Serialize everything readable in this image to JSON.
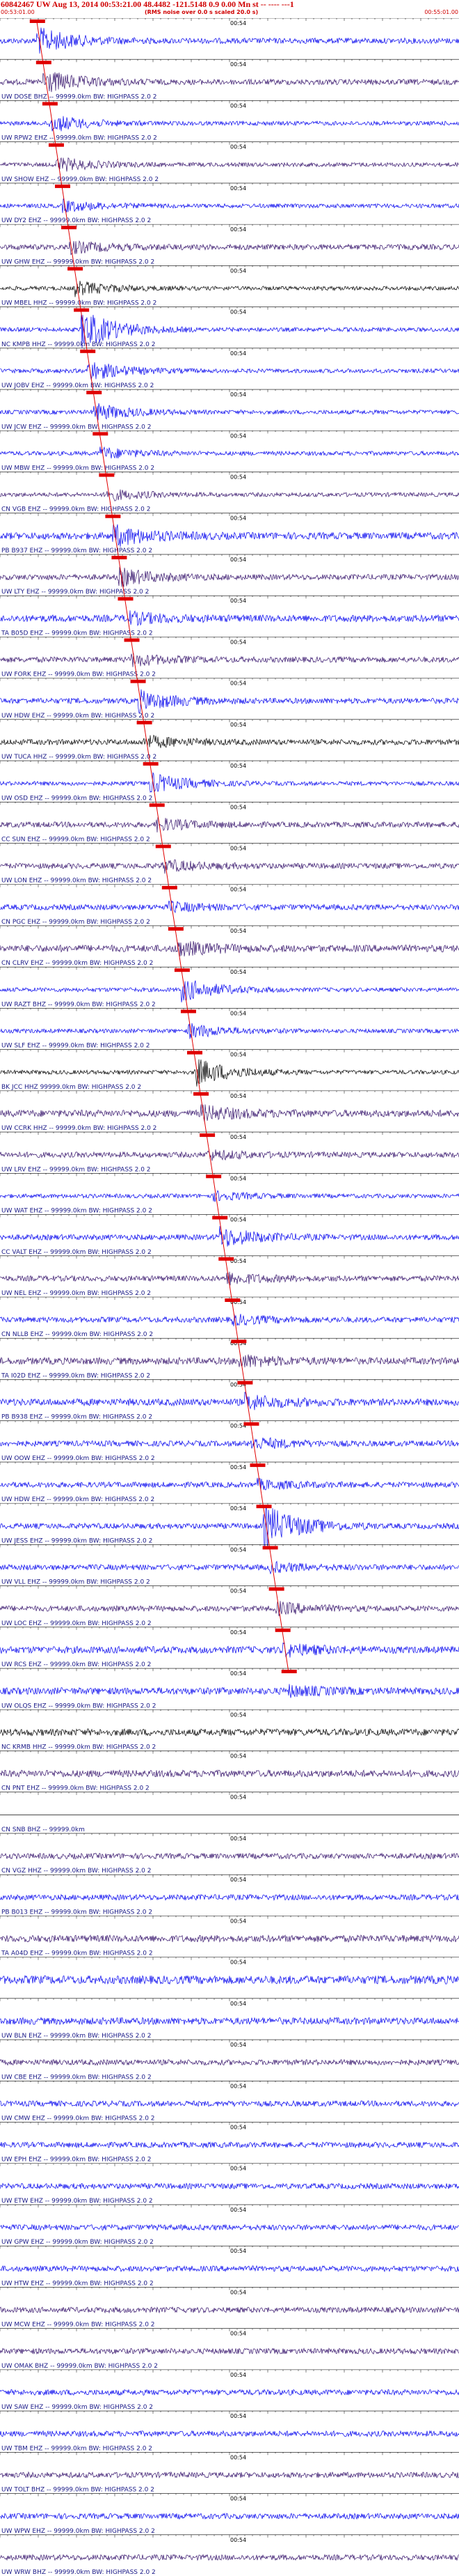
{
  "header": {
    "title": "60842467 UW Aug 13, 2014 00:53:21.00   48.4482 -121.5148   0.9 0.00 Mn st -- ---- ---1",
    "subtitle": "(RMS noise over 0.0 s scaled 20.0 s)",
    "time_left": "00:53:01.00",
    "time_right": "00:55:01.00"
  },
  "tick_time": "00:54",
  "colors": {
    "pick": "#e00000",
    "blue": "#0000ee",
    "purple": "#33106a",
    "black": "#000000"
  },
  "traces": [
    {
      "label": "",
      "color": "blue",
      "amp": 18,
      "noise": 4,
      "event": true
    },
    {
      "label": "UW DOSE BHZ -- 99999.0km BW: HIGHPASS 2.0 2",
      "color": "purple",
      "amp": 16,
      "noise": 4,
      "event": true
    },
    {
      "label": "UW RPW2 EHZ -- 99999.0km BW: HIGHPASS 2.0 2",
      "color": "blue",
      "amp": 12,
      "noise": 3,
      "event": true
    },
    {
      "label": "UW SHOW EHZ -- 99999.0km BW: HIGHPASS 2.0 2",
      "color": "purple",
      "amp": 10,
      "noise": 3,
      "event": true
    },
    {
      "label": "UW DY2 EHZ -- 99999.0km BW: HIGHPASS 2.0 2",
      "color": "blue",
      "amp": 8,
      "noise": 3,
      "event": true
    },
    {
      "label": "UW GHW EHZ -- 99999.0km BW: HIGHPASS 2.0 2",
      "color": "purple",
      "amp": 8,
      "noise": 4,
      "event": true
    },
    {
      "label": "UW MBEL HHZ -- 99999.0km BW: HIGHPASS 2.0 2",
      "color": "black",
      "amp": 10,
      "noise": 3,
      "event": true
    },
    {
      "label": "NC KMPB HHZ -- 99999.0km BW: HIGHPASS 2.0 2",
      "color": "blue",
      "amp": 28,
      "noise": 3,
      "event": true
    },
    {
      "label": "UW JOBV EHZ -- 99999.0km BW: HIGHPASS 2.0 2",
      "color": "blue",
      "amp": 14,
      "noise": 3,
      "event": true
    },
    {
      "label": "UW JCW EHZ -- 99999.0km BW: HIGHPASS 2.0 2",
      "color": "blue",
      "amp": 12,
      "noise": 3,
      "event": true
    },
    {
      "label": "UW MBW EHZ -- 99999.0km BW: HIGHPASS 2.0 2",
      "color": "blue",
      "amp": 8,
      "noise": 3,
      "event": true
    },
    {
      "label": "CN VGB EHZ -- 99999.0km BW: HIGHPASS 2.0 2",
      "color": "purple",
      "amp": 8,
      "noise": 3,
      "event": true
    },
    {
      "label": "PB B937 EHZ -- 99999.0km BW: HIGHPASS 2.0 2",
      "color": "blue",
      "amp": 14,
      "noise": 5,
      "event": true
    },
    {
      "label": "UW LTY EHZ -- 99999.0km BW: HIGHPASS 2.0 2",
      "color": "purple",
      "amp": 12,
      "noise": 4,
      "event": true
    },
    {
      "label": "TA B05D EHZ -- 99999.0km BW: HIGHPASS 2.0 2",
      "color": "blue",
      "amp": 8,
      "noise": 5,
      "event": true
    },
    {
      "label": "UW FORK EHZ -- 99999.0km BW: HIGHPASS 2.0 2",
      "color": "purple",
      "amp": 8,
      "noise": 4,
      "event": true
    },
    {
      "label": "UW HDW EHZ -- 99999.0km BW: HIGHPASS 2.0 2",
      "color": "blue",
      "amp": 14,
      "noise": 4,
      "event": true
    },
    {
      "label": "UW TUCA HHZ -- 99999.0km BW: HIGHPASS 2.0 2",
      "color": "black",
      "amp": 8,
      "noise": 4,
      "event": true
    },
    {
      "label": "UW OSD EHZ -- 99999.0km BW: HIGHPASS 2.0 2",
      "color": "blue",
      "amp": 14,
      "noise": 3,
      "event": true
    },
    {
      "label": "CC SUN EHZ -- 99999.0km BW: HIGHPASS 2.0 2",
      "color": "purple",
      "amp": 8,
      "noise": 4,
      "event": true
    },
    {
      "label": "UW LON EHZ -- 99999.0km BW: HIGHPASS 2.0 2",
      "color": "purple",
      "amp": 8,
      "noise": 4,
      "event": true
    },
    {
      "label": "CN PGC EHZ -- 99999.0km BW: HIGHPASS 2.0 2",
      "color": "blue",
      "amp": 6,
      "noise": 4,
      "event": true
    },
    {
      "label": "CN CLRV EHZ -- 99999.0km BW: HIGHPASS 2.0 2",
      "color": "purple",
      "amp": 10,
      "noise": 5,
      "event": true
    },
    {
      "label": "UW RAZT BHZ -- 99999.0km BW: HIGHPASS 2.0 2",
      "color": "blue",
      "amp": 16,
      "noise": 3,
      "event": true
    },
    {
      "label": "UW SLF EHZ -- 99999.0km BW: HIGHPASS 2.0 2",
      "color": "blue",
      "amp": 10,
      "noise": 3,
      "event": true
    },
    {
      "label": "BK JCC HHZ 99999.0km BW: HIGHPASS 2.0 2",
      "color": "black",
      "amp": 20,
      "noise": 3,
      "event": true
    },
    {
      "label": "UW CCRK HHZ -- 99999.0km BW: HIGHPASS 2.0 2",
      "color": "purple",
      "amp": 10,
      "noise": 5,
      "event": true
    },
    {
      "label": "UW LRV EHZ -- 99999.0km BW: HIGHPASS 2.0 2",
      "color": "purple",
      "amp": 6,
      "noise": 4,
      "event": true
    },
    {
      "label": "UW WAT EHZ -- 99999.0km BW: HIGHPASS 2.0 2",
      "color": "blue",
      "amp": 6,
      "noise": 3,
      "event": true
    },
    {
      "label": "CC VALT EHZ -- 99999.0km BW: HIGHPASS 2.0 2",
      "color": "blue",
      "amp": 14,
      "noise": 4,
      "event": true
    },
    {
      "label": "UW NEL EHZ -- 99999.0km BW: HIGHPASS 2.0 2",
      "color": "purple",
      "amp": 8,
      "noise": 4,
      "event": true
    },
    {
      "label": "CN NLLB EHZ -- 99999.0km BW: HIGHPASS 2.0 2",
      "color": "blue",
      "amp": 6,
      "noise": 4,
      "event": true
    },
    {
      "label": "TA I02D EHZ -- 99999.0km BW: HIGHPASS 2.0 2",
      "color": "purple",
      "amp": 8,
      "noise": 5,
      "event": true
    },
    {
      "label": "PB B938 EHZ -- 99999.0km BW: HIGHPASS 2.0 2",
      "color": "blue",
      "amp": 10,
      "noise": 5,
      "event": true
    },
    {
      "label": "UW OOW EHZ -- 99999.0km BW: HIGHPASS 2.0 2",
      "color": "blue",
      "amp": 8,
      "noise": 4,
      "event": true
    },
    {
      "label": "UW HDW EHZ -- 99999.0km BW: HIGHPASS 2.0 2",
      "color": "blue",
      "amp": 6,
      "noise": 4,
      "event": true
    },
    {
      "label": "UW JESS EHZ -- 99999.0km BW: HIGHPASS 2.0 2",
      "color": "blue",
      "amp": 30,
      "noise": 4,
      "event": true
    },
    {
      "label": "UW VLL EHZ -- 99999.0km BW: HIGHPASS 2.0 2",
      "color": "blue",
      "amp": 6,
      "noise": 4,
      "event": true
    },
    {
      "label": "UW LOC EHZ -- 99999.0km BW: HIGHPASS 2.0 2",
      "color": "purple",
      "amp": 8,
      "noise": 4,
      "event": true
    },
    {
      "label": "UW RCS EHZ -- 99999.0km BW: HIGHPASS 2.0 2",
      "color": "blue",
      "amp": 8,
      "noise": 5,
      "event": true
    },
    {
      "label": "UW OLQS EHZ -- 99999.0km BW: HIGHPASS 2.0 2",
      "color": "blue",
      "amp": 6,
      "noise": 5,
      "event": true
    },
    {
      "label": "NC KRMB HHZ -- 99999.0km BW: HIGHPASS 2.0 2",
      "color": "black",
      "amp": 6,
      "noise": 5,
      "event": false
    },
    {
      "label": "CN PNT EHZ -- 99999.0km BW: HIGHPASS 2.0 2",
      "color": "purple",
      "amp": 6,
      "noise": 5,
      "event": false
    },
    {
      "label": "CN SNB BHZ -- 99999.0km",
      "color": "black",
      "amp": 0,
      "noise": 0,
      "event": false
    },
    {
      "label": "CN VGZ HHZ -- 99999.0km BW: HIGHPASS 2.0 2",
      "color": "purple",
      "amp": 6,
      "noise": 4,
      "event": false
    },
    {
      "label": "PB B013 EHZ -- 99999.0km BW: HIGHPASS 2.0 2",
      "color": "blue",
      "amp": 6,
      "noise": 4,
      "event": false
    },
    {
      "label": "TA A04D EHZ -- 99999.0km BW: HIGHPASS 2.0 2",
      "color": "purple",
      "amp": 6,
      "noise": 5,
      "event": false
    },
    {
      "label": "",
      "color": "blue",
      "amp": 6,
      "noise": 6,
      "event": false
    },
    {
      "label": "UW BLN EHZ -- 99999.0km BW: HIGHPASS 2.0 2",
      "color": "blue",
      "amp": 6,
      "noise": 5,
      "event": false
    },
    {
      "label": "UW CBE EHZ -- 99999.0km BW: HIGHPASS 2.0 2",
      "color": "purple",
      "amp": 6,
      "noise": 4,
      "event": false
    },
    {
      "label": "UW CMW EHZ -- 99999.0km BW: HIGHPASS 2.0 2",
      "color": "blue",
      "amp": 6,
      "noise": 4,
      "event": false
    },
    {
      "label": "UW EPH EHZ -- 99999.0km BW: HIGHPASS 2.0 2",
      "color": "blue",
      "amp": 6,
      "noise": 4,
      "event": false
    },
    {
      "label": "UW ETW EHZ -- 99999.0km BW: HIGHPASS 2.0 2",
      "color": "blue",
      "amp": 6,
      "noise": 4,
      "event": false
    },
    {
      "label": "UW GPW EHZ -- 99999.0km BW: HIGHPASS 2.0 2",
      "color": "blue",
      "amp": 6,
      "noise": 4,
      "event": false
    },
    {
      "label": "UW HTW EHZ -- 99999.0km BW: HIGHPASS 2.0 2",
      "color": "blue",
      "amp": 6,
      "noise": 4,
      "event": false
    },
    {
      "label": "UW MCW EHZ -- 99999.0km BW: HIGHPASS 2.0 2",
      "color": "purple",
      "amp": 6,
      "noise": 4,
      "event": false
    },
    {
      "label": "UW OMAK BHZ -- 99999.0km BW: HIGHPASS 2.0 2",
      "color": "purple",
      "amp": 6,
      "noise": 4,
      "event": false
    },
    {
      "label": "UW SAW EHZ -- 99999.0km BW: HIGHPASS 2.0 2",
      "color": "blue",
      "amp": 6,
      "noise": 4,
      "event": false
    },
    {
      "label": "UW TBM EHZ -- 99999.0km BW: HIGHPASS 2.0 2",
      "color": "blue",
      "amp": 6,
      "noise": 4,
      "event": false
    },
    {
      "label": "UW TOLT BHZ -- 99999.0km BW: HIGHPASS 2.0 2",
      "color": "purple",
      "amp": 6,
      "noise": 4,
      "event": false
    },
    {
      "label": "UW WPW EHZ -- 99999.0km BW: HIGHPASS 2.0 2",
      "color": "blue",
      "amp": 6,
      "noise": 4,
      "event": false
    },
    {
      "label": "UW WRW BHZ -- 99999.0km BW: HIGHPASS 2.0 2",
      "color": "purple",
      "amp": 6,
      "noise": 4,
      "event": false
    }
  ]
}
